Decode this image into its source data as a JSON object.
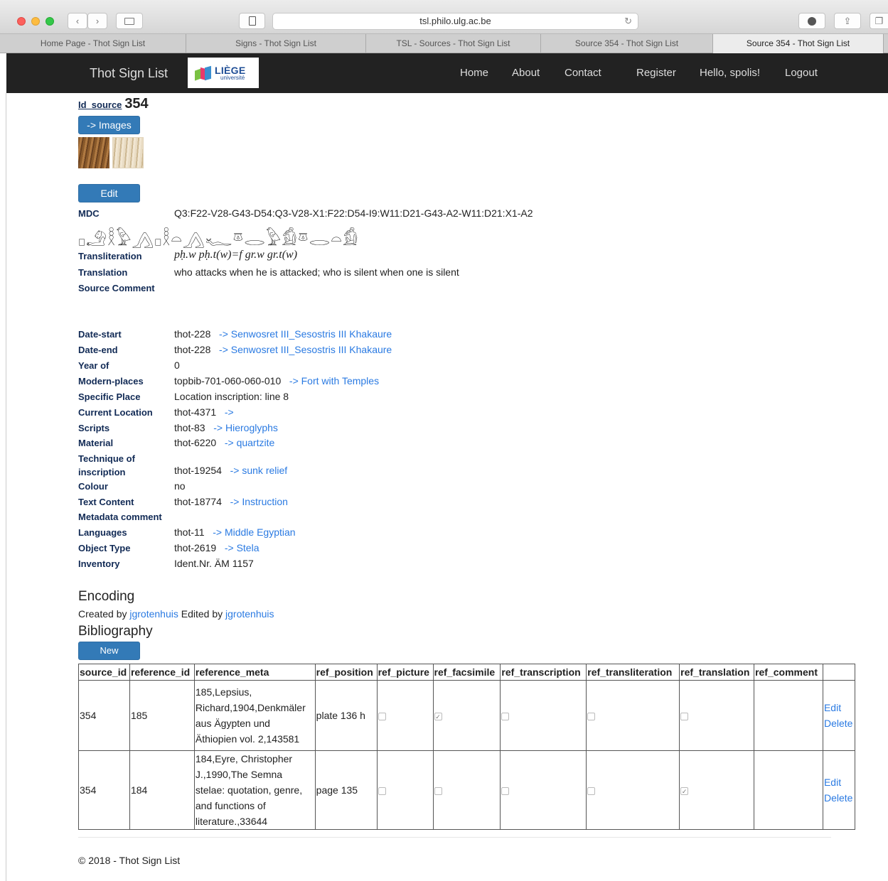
{
  "browser": {
    "url": "tsl.philo.ulg.ac.be",
    "tabs": [
      "Home Page - Thot Sign List",
      "Signs - Thot Sign List",
      "TSL - Sources - Thot Sign List",
      "Source 354 - Thot Sign List",
      "Source 354 - Thot Sign List"
    ]
  },
  "navbar": {
    "brand": "Thot Sign List",
    "logo_line1": "LIÈGE",
    "logo_line2": "université",
    "links": [
      "Home",
      "About",
      "Contact",
      "Register",
      "Hello, spolis!",
      "Logout"
    ]
  },
  "source": {
    "id_label": "Id_source",
    "id_value": "354",
    "images_button": "-> Images",
    "edit_button": "Edit",
    "mdc_label": "MDC",
    "mdc_value": "Q3:F22-V28-G43-D54:Q3-V28-X1:F22:D54-I9:W11:D21-G43-A2-W11:D21:X1-A2",
    "hieroglyphs": "𓊪𓄂𓎛𓅱𓂻𓊪𓎛𓏏𓂻𓆑𓎼𓂋𓅱𓀁𓎼𓂋𓏏𓀁",
    "transliteration_label": "Transliteration",
    "transliteration_value": "pḥ.w pḥ.t(w)=f gr.w gr.t(w)",
    "translation_label": "Translation",
    "translation_value": "who attacks when he is attacked; who is silent when one is silent",
    "source_comment_label": "Source Comment"
  },
  "metadata": [
    {
      "label": "Date-start",
      "value": "thot-228",
      "link": "-> Senwosret III_Sesostris III Khakaure"
    },
    {
      "label": "Date-end",
      "value": "thot-228",
      "link": "-> Senwosret III_Sesostris III Khakaure"
    },
    {
      "label": "Year of",
      "value": "0",
      "link": ""
    },
    {
      "label": "Modern-places",
      "value": "topbib-701-060-060-010",
      "link": "-> Fort with Temples"
    },
    {
      "label": "Specific Place",
      "value": "Location inscription: line 8",
      "link": ""
    },
    {
      "label": "Current Location",
      "value": "thot-4371",
      "link": "->"
    },
    {
      "label": "Scripts",
      "value": "thot-83",
      "link": "-> Hieroglyphs"
    },
    {
      "label": "Material",
      "value": "thot-6220",
      "link": "-> quartzite"
    },
    {
      "label": "Technique of inscription",
      "value": "thot-19254",
      "link": "-> sunk relief"
    },
    {
      "label": "Colour",
      "value": "no",
      "link": ""
    },
    {
      "label": "Text Content",
      "value": "thot-18774",
      "link": "-> Instruction"
    },
    {
      "label": "Metadata comment",
      "value": "",
      "link": ""
    },
    {
      "label": "Languages",
      "value": "thot-11",
      "link": "-> Middle Egyptian"
    },
    {
      "label": "Object Type",
      "value": "thot-2619",
      "link": "-> Stela"
    },
    {
      "label": "Inventory",
      "value": "Ident.Nr. ÄM 1157",
      "link": ""
    }
  ],
  "encoding": {
    "heading": "Encoding",
    "created_prefix": "Created by",
    "created_by": "jgrotenhuis",
    "edited_prefix": "Edited by",
    "edited_by": "jgrotenhuis"
  },
  "bibliography": {
    "heading": "Bibliography",
    "new_button": "New",
    "columns": [
      "source_id",
      "reference_id",
      "reference_meta",
      "ref_position",
      "ref_picture",
      "ref_facsimile",
      "ref_transcription",
      "ref_transliteration",
      "ref_translation",
      "ref_comment",
      ""
    ],
    "rows": [
      {
        "source_id": "354",
        "reference_id": "185",
        "reference_meta": "185,Lepsius, Richard,1904,Denkmäler aus Ägypten und Äthiopien vol. 2,143581",
        "ref_position": "plate 136 h",
        "checks": [
          false,
          true,
          false,
          false,
          false
        ],
        "ref_comment": "",
        "edit": "Edit",
        "delete": "Delete"
      },
      {
        "source_id": "354",
        "reference_id": "184",
        "reference_meta": "184,Eyre, Christopher J.,1990,The Semna stelae: quotation, genre, and functions of literature.,33644",
        "ref_position": "page 135",
        "checks": [
          false,
          false,
          false,
          false,
          true
        ],
        "ref_comment": "",
        "edit": "Edit",
        "delete": "Delete"
      }
    ]
  },
  "footer": "© 2018 - Thot Sign List"
}
